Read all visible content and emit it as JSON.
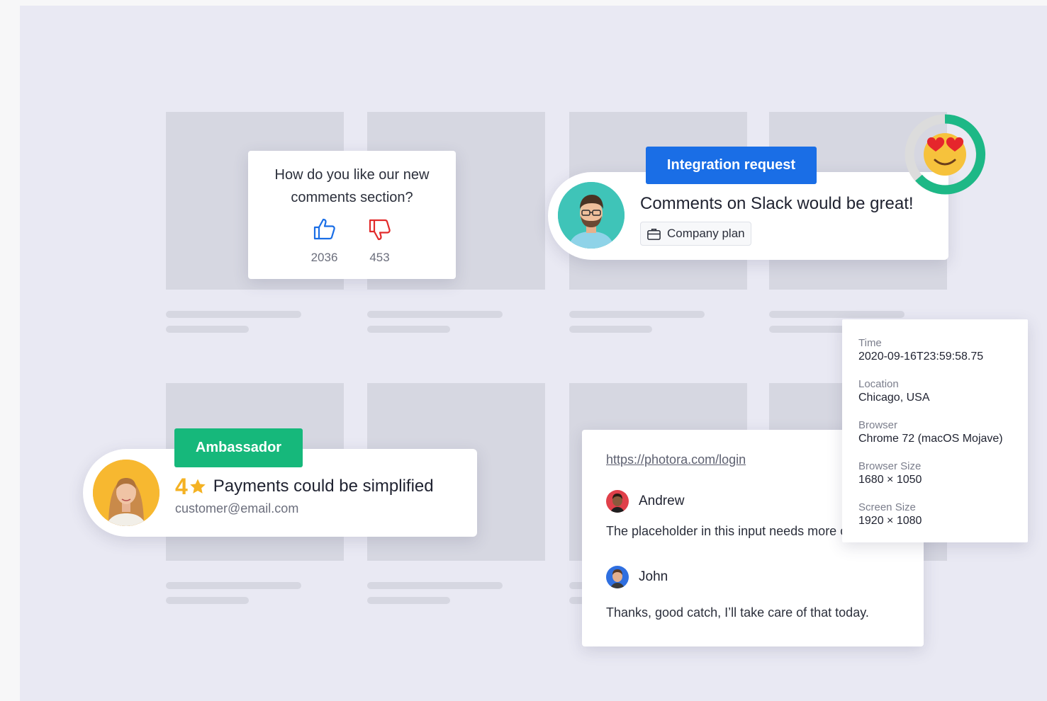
{
  "poll": {
    "question": "How do you like our new comments section?",
    "like_count": "2036",
    "dislike_count": "453"
  },
  "integration": {
    "tag": "Integration request",
    "comment": "Comments on Slack would be great!",
    "plan": "Company plan"
  },
  "ambassador": {
    "tag": "Ambassador",
    "rating": "4",
    "comment": "Payments could be simplified",
    "email": "customer@email.com"
  },
  "thread": {
    "url": "https://photora.com/login",
    "messages": [
      {
        "author": "Andrew",
        "text": "The placeholder in this input needs more contrast."
      },
      {
        "author": "John",
        "text": "Thanks, good catch, I’ll take care of that today."
      }
    ]
  },
  "metadata": [
    {
      "label": "Time",
      "value": "2020-09-16T23:59:58.75"
    },
    {
      "label": "Location",
      "value": "Chicago, USA"
    },
    {
      "label": "Browser",
      "value": "Chrome 72 (macOS Mojave)"
    },
    {
      "label": "Browser Size",
      "value": "1680 × 1050"
    },
    {
      "label": "Screen Size",
      "value": "1920 × 1080"
    }
  ],
  "colors": {
    "primary_blue": "#1a6ee6",
    "ambassador_green": "#16b87b",
    "rating_gold": "#f4b223",
    "dislike_red": "#e22b2b",
    "ring_green": "#1db886"
  }
}
